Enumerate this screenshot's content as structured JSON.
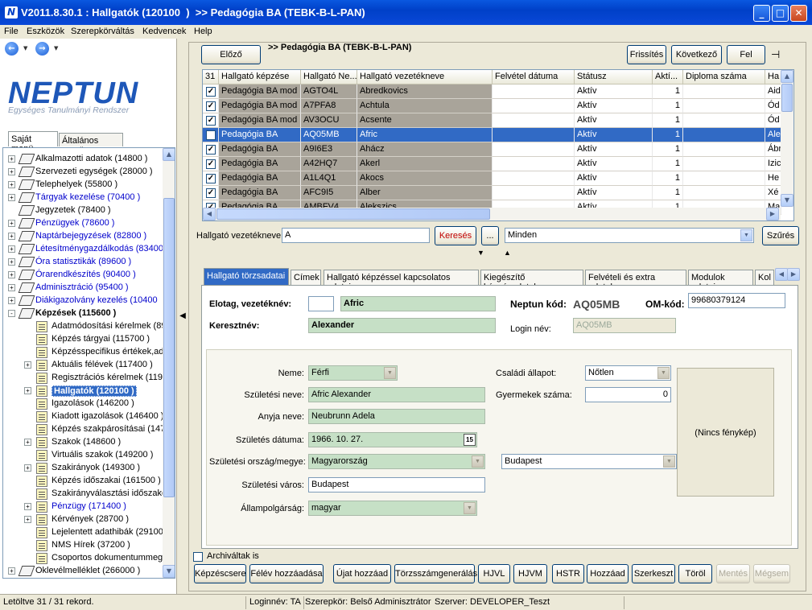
{
  "window": {
    "title": "V2011.8.30.1 : Hallgatók (120100  )  >> Pedagógia BA (TEBK-B-L-PAN)",
    "app_icon": "N"
  },
  "menu": [
    "File",
    "Eszközök",
    "Szerepkörváltás",
    "Kedvencek",
    "Help"
  ],
  "logo": {
    "name": "NEPTUN",
    "tagline": "Egységes Tanulmányi Rendszer"
  },
  "left_tabs": [
    "Saját menü",
    "Általános menü"
  ],
  "tree": [
    {
      "label": "Alkalmazotti adatok (14800  )",
      "level": 0,
      "exp": "+",
      "icon": "book",
      "blue": false
    },
    {
      "label": "Szervezeti egységek (28000  )",
      "level": 0,
      "exp": "+",
      "icon": "book",
      "blue": false
    },
    {
      "label": "Telephelyek (55800  )",
      "level": 0,
      "exp": "+",
      "icon": "book",
      "blue": false
    },
    {
      "label": "Tárgyak kezelése (70400  )",
      "level": 0,
      "exp": "+",
      "icon": "book",
      "blue": true
    },
    {
      "label": "Jegyzetek (78400  )",
      "level": 0,
      "exp": "",
      "icon": "book",
      "blue": false
    },
    {
      "label": "Pénzügyek (78600  )",
      "level": 0,
      "exp": "+",
      "icon": "book",
      "blue": true
    },
    {
      "label": "Naptárbejegyzések (82800  )",
      "level": 0,
      "exp": "+",
      "icon": "book",
      "blue": true
    },
    {
      "label": "Létesítménygazdálkodás (83400",
      "level": 0,
      "exp": "+",
      "icon": "book",
      "blue": true
    },
    {
      "label": "Óra statisztikák (89600  )",
      "level": 0,
      "exp": "+",
      "icon": "book",
      "blue": true
    },
    {
      "label": "Órarendkészítés (90400  )",
      "level": 0,
      "exp": "+",
      "icon": "book",
      "blue": true
    },
    {
      "label": "Adminisztráció (95400  )",
      "level": 0,
      "exp": "+",
      "icon": "book",
      "blue": true
    },
    {
      "label": "Diákigazolvány kezelés (10400",
      "level": 0,
      "exp": "+",
      "icon": "book",
      "blue": true
    },
    {
      "label": "Képzések (115600  )",
      "level": 0,
      "exp": "-",
      "icon": "book",
      "blue": false,
      "bold": true
    },
    {
      "label": "Adatmódosítási kérelmek (890",
      "level": 1,
      "exp": "",
      "icon": "pin",
      "blue": false
    },
    {
      "label": "Képzés tárgyai (115700  )",
      "level": 1,
      "exp": "",
      "icon": "pin",
      "blue": false
    },
    {
      "label": "Képzésspecifikus értékek,ada",
      "level": 1,
      "exp": "",
      "icon": "pin",
      "blue": false
    },
    {
      "label": "Aktuális félévek (117400  )",
      "level": 1,
      "exp": "+",
      "icon": "pin",
      "blue": false
    },
    {
      "label": "Regisztrációs kérelmek (1192",
      "level": 1,
      "exp": "",
      "icon": "pin",
      "blue": false
    },
    {
      "label": "Hallgatók (120100  )",
      "level": 1,
      "exp": "+",
      "icon": "pin",
      "blue": false,
      "selected": true
    },
    {
      "label": "Igazolások (146200  )",
      "level": 1,
      "exp": "",
      "icon": "pin",
      "blue": false
    },
    {
      "label": "Kiadott igazolások (146400  )",
      "level": 1,
      "exp": "",
      "icon": "pin",
      "blue": false
    },
    {
      "label": "Képzés szakpárosításai (1471",
      "level": 1,
      "exp": "",
      "icon": "pin",
      "blue": false
    },
    {
      "label": "Szakok (148600  )",
      "level": 1,
      "exp": "+",
      "icon": "pin",
      "blue": false
    },
    {
      "label": "Virtuális szakok (149200  )",
      "level": 1,
      "exp": "",
      "icon": "pin",
      "blue": false
    },
    {
      "label": "Szakirányok (149300  )",
      "level": 1,
      "exp": "+",
      "icon": "pin",
      "blue": false
    },
    {
      "label": "Képzés időszakai (161500  )",
      "level": 1,
      "exp": "",
      "icon": "pin",
      "blue": false
    },
    {
      "label": "Szakirányválasztási időszakol",
      "level": 1,
      "exp": "",
      "icon": "pin",
      "blue": false
    },
    {
      "label": "Pénzügy (171400  )",
      "level": 1,
      "exp": "+",
      "icon": "pin",
      "blue": true
    },
    {
      "label": "Kérvények (28700  )",
      "level": 1,
      "exp": "+",
      "icon": "pin",
      "blue": false
    },
    {
      "label": "Lejelentett adathibák (29100",
      "level": 1,
      "exp": "",
      "icon": "pin",
      "blue": false
    },
    {
      "label": "NMS Hírek (37200  )",
      "level": 1,
      "exp": "",
      "icon": "pin",
      "blue": false
    },
    {
      "label": "Csoportos dokumentummegte",
      "level": 1,
      "exp": "",
      "icon": "pin",
      "blue": false
    },
    {
      "label": "Oklevélmelléklet (266000  )",
      "level": 0,
      "exp": "+",
      "icon": "book",
      "blue": false
    }
  ],
  "top_toolbar": {
    "prev": "Előző",
    "crumb": ">> Pedagógia BA (TEBK-B-L-PAN)",
    "refresh": "Frissítés",
    "next": "Következő",
    "up": "Fel"
  },
  "grid": {
    "columns": [
      "31",
      "Hallgató képzése",
      "Hallgató Ne...",
      "Hallgató vezetékneve",
      "Felvétel dátuma",
      "Státusz",
      "Aktí...",
      "Diploma száma",
      "Ha"
    ],
    "rows": [
      {
        "kepzes": "Pedagógia BA mod",
        "kod": "AGTO4L",
        "nev": "Abredkovics",
        "statusz": "Aktív",
        "akt": "1",
        "ha": "Aid"
      },
      {
        "kepzes": "Pedagógia BA mod",
        "kod": "A7PFA8",
        "nev": "Achtula",
        "statusz": "Aktív",
        "akt": "1",
        "ha": "Ód"
      },
      {
        "kepzes": "Pedagógia BA mod",
        "kod": "AV3OCU",
        "nev": "Acsente",
        "statusz": "Aktív",
        "akt": "1",
        "ha": "Ód"
      },
      {
        "kepzes": "Pedagógia BA",
        "kod": "AQ05MB",
        "nev": "Afric",
        "statusz": "Aktív",
        "akt": "1",
        "ha": "Ale"
      },
      {
        "kepzes": "Pedagógia BA",
        "kod": "A9I6E3",
        "nev": "Ahácz",
        "statusz": "Aktív",
        "akt": "1",
        "ha": "Ábr"
      },
      {
        "kepzes": "Pedagógia BA",
        "kod": "A42HQ7",
        "nev": "Akerl",
        "statusz": "Aktív",
        "akt": "1",
        "ha": "Izic"
      },
      {
        "kepzes": "Pedagógia BA",
        "kod": "A1L4Q1",
        "nev": "Akocs",
        "statusz": "Aktív",
        "akt": "1",
        "ha": "He"
      },
      {
        "kepzes": "Pedagógia BA",
        "kod": "AFC9I5",
        "nev": "Alber",
        "statusz": "Aktív",
        "akt": "1",
        "ha": "Xé"
      },
      {
        "kepzes": "Pedagógia BA",
        "kod": "AMBFV4",
        "nev": "Alekszics",
        "statusz": "Aktív",
        "akt": "1",
        "ha": "Ma"
      }
    ]
  },
  "search": {
    "label": "Hallgató vezetékneve",
    "value": "A",
    "button": "Keresés",
    "ellipsis": "...",
    "filter": "Minden",
    "filter_button": "Szűrés"
  },
  "tabs": [
    "Hallgató törzsadatai",
    "Címek",
    "Hallgató képzéssel kapcsolatos adatai",
    "Kiegészítő képzésadatok",
    "Felvételi és extra adatok",
    "Modulok adatai",
    "Kol"
  ],
  "student": {
    "elotag_label": "Elotag, vezetéknév:",
    "elotag": "",
    "vezeteknev": "Afric",
    "keresztnev_label": "Keresztnév:",
    "keresztnev": "Alexander",
    "neptun_label": "Neptun kód:",
    "neptun_kod": "AQ05MB",
    "om_label": "OM-kód:",
    "om_kod": "99680379124",
    "login_label": "Login név:",
    "login": "AQ05MB"
  },
  "details": {
    "neme_label": "Neme:",
    "neme": "Férfi",
    "szuletesi_nev_label": "Születési neve:",
    "szuletesi_nev": "Afric Alexander",
    "anyja_label": "Anyja neve:",
    "anyja": "Neubrunn Adela",
    "datum_label": "Születés dátuma:",
    "datum": "1966. 10. 27.",
    "date_picker_icon": "15",
    "orszag_label": "Születési ország/megye:",
    "orszag": "Magyarország",
    "megye": "Budapest",
    "varos_label": "Születési város:",
    "varos": "Budapest",
    "allampolgarsag_label": "Állampolgárság:",
    "allampolgarsag": "magyar",
    "csaladi_label": "Családi állapot:",
    "csaladi": "Nőtlen",
    "gyermekek_label": "Gyermekek száma:",
    "gyermekek": "0",
    "photo": "(Nincs fénykép)"
  },
  "archived_label": "Archiváltak is",
  "bottom_buttons": [
    {
      "label": "Képzéscsere",
      "disabled": false
    },
    {
      "label": "Félév hozzáadása",
      "disabled": false
    },
    {
      "label": "Újat hozzáad",
      "disabled": false
    },
    {
      "label": "Törzsszámgenerálás",
      "disabled": false
    },
    {
      "label": "HJVL",
      "disabled": false
    },
    {
      "label": "HJVM",
      "disabled": false
    },
    {
      "label": "HSTR",
      "disabled": false
    },
    {
      "label": "Hozzáad",
      "disabled": false
    },
    {
      "label": "Szerkeszt",
      "disabled": false
    },
    {
      "label": "Töröl",
      "disabled": false
    },
    {
      "label": "Mentés",
      "disabled": true
    },
    {
      "label": "Mégsem",
      "disabled": true
    }
  ],
  "status": {
    "records": "Letöltve 31 / 31 rekord.",
    "login": "Loginnév: TA",
    "role": "Szerepkör: Belső Adminisztrátor",
    "server": "Szerver: DEVELOPER_Teszt"
  }
}
